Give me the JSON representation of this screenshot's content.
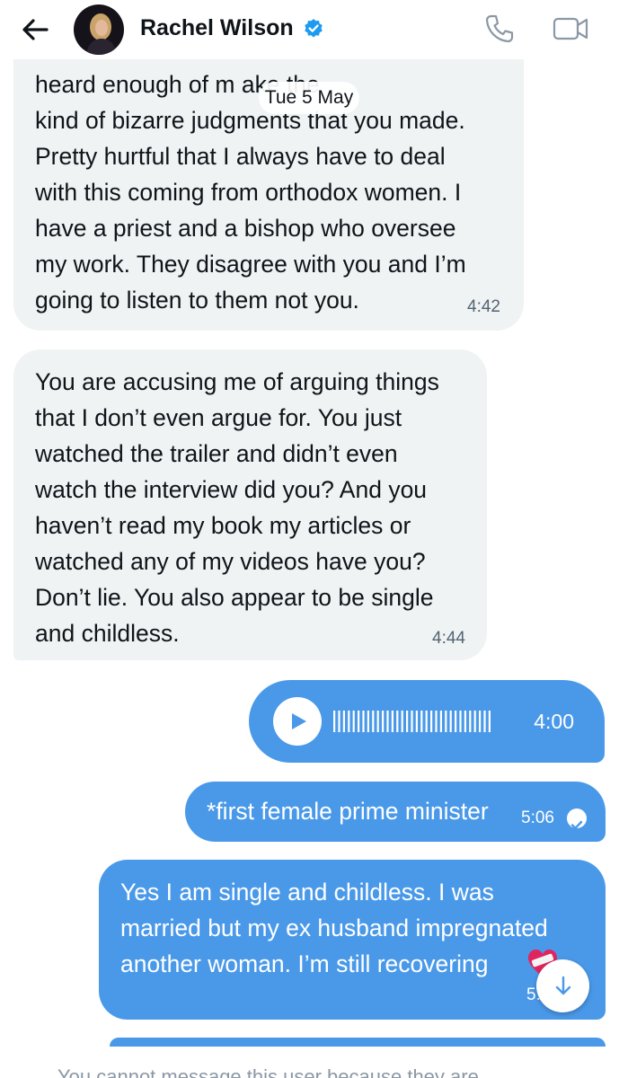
{
  "header": {
    "contact_name": "Rachel Wilson",
    "back_icon": "arrow-left-icon",
    "verified_icon": "verified-badge-icon",
    "call_icon": "phone-icon",
    "video_icon": "video-camera-icon",
    "accent": "#1d9bf0"
  },
  "date_separator": "Tue 5 May",
  "messages": [
    {
      "direction": "incoming",
      "text": "heard enough of m          ake the\nkind of bizarre judgments that you made.\nPretty hurtful that I always have to deal\nwith this coming from orthodox women. I\nhave a priest and a bishop who oversee\nmy work. They disagree with you and I’m\ngoing to listen to them not you.",
      "time": "4:42"
    },
    {
      "direction": "incoming",
      "text": "You are accusing me of arguing things\nthat I don’t even argue for. You just\nwatched the trailer and didn’t even\nwatch the interview did you? And you\nhaven’t read my book my articles or\nwatched any of my videos have you?\nDon’t lie. You also appear to be single\nand childless.",
      "time": "4:44"
    },
    {
      "direction": "outgoing",
      "type": "voice",
      "duration": "4:00",
      "play_icon": "play-icon"
    },
    {
      "direction": "outgoing",
      "text": "*first female prime minister",
      "time": "5:06",
      "status_icon": "read-check-icon"
    },
    {
      "direction": "outgoing",
      "text": "Yes I am single and childless. I was\nmarried but my ex husband impregnated\nanother woman. I’m still recovering",
      "emoji_icon": "heart-bandage-icon",
      "time": "5:"
    }
  ],
  "scroll_down_icon": "arrow-down-icon",
  "footer_text": "You cannot message this user because they are",
  "colors": {
    "incoming_bubble": "#eff3f4",
    "outgoing_bubble": "#4a99e9",
    "timestamp_in": "#536471"
  }
}
